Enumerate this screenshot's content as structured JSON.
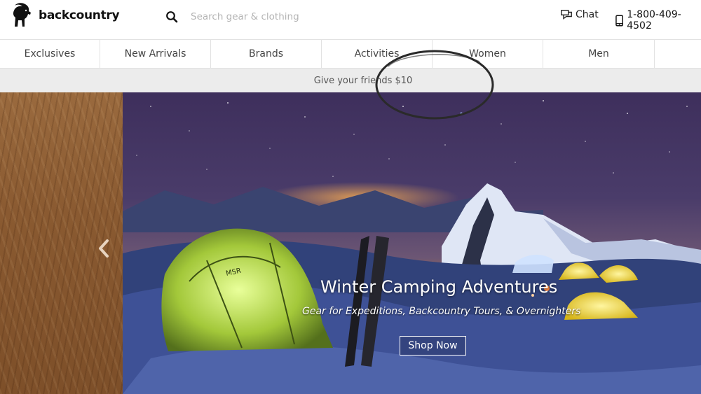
{
  "header": {
    "logo_text": "backcountry",
    "logo_icon": "goat-icon",
    "search": {
      "icon": "search-icon",
      "placeholder": "Search gear & clothing",
      "value": ""
    },
    "chat_label": "Chat",
    "chat_icon": "chat-icon",
    "phone_number": "1-800-409-4502",
    "phone_icon": "mobile-phone-icon"
  },
  "nav": {
    "items": [
      {
        "label": "Exclusives"
      },
      {
        "label": "New Arrivals"
      },
      {
        "label": "Brands"
      },
      {
        "label": "Activities"
      },
      {
        "label": "Women"
      },
      {
        "label": "Men"
      }
    ]
  },
  "promo": {
    "text": "Give your friends $10",
    "annotation": "hand-drawn circle around promo text"
  },
  "hero": {
    "title": "Winter Camping Adventures",
    "subtitle": "Gear for Expeditions, Backcountry Tours, & Overnighters",
    "cta_label": "Shop Now",
    "prev_icon": "chevron-left-icon"
  },
  "colors": {
    "promo_bar": "#ececec",
    "nav_border": "#e2e2e2",
    "text_dark": "#111111",
    "placeholder": "#b4b4b4"
  }
}
